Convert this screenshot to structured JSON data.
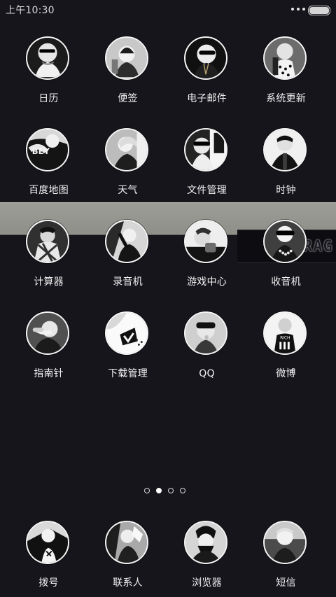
{
  "status_bar": {
    "time": "上午10:30",
    "icons": [
      "more-dots-icon",
      "battery-icon"
    ]
  },
  "apps": [
    {
      "name": "calendar",
      "label": "日历",
      "icon": "calendar-icon"
    },
    {
      "name": "notes",
      "label": "便签",
      "icon": "notes-icon"
    },
    {
      "name": "email",
      "label": "电子邮件",
      "icon": "email-icon"
    },
    {
      "name": "system-update",
      "label": "系统更新",
      "icon": "system-update-icon"
    },
    {
      "name": "baidu-map",
      "label": "百度地图",
      "icon": "map-icon"
    },
    {
      "name": "weather",
      "label": "天气",
      "icon": "weather-icon"
    },
    {
      "name": "file-manager",
      "label": "文件管理",
      "icon": "file-manager-icon"
    },
    {
      "name": "clock",
      "label": "时钟",
      "icon": "clock-icon"
    },
    {
      "name": "calculator",
      "label": "计算器",
      "icon": "calculator-icon"
    },
    {
      "name": "recorder",
      "label": "录音机",
      "icon": "recorder-icon"
    },
    {
      "name": "game-center",
      "label": "游戏中心",
      "icon": "game-center-icon"
    },
    {
      "name": "radio",
      "label": "收音机",
      "icon": "radio-icon"
    },
    {
      "name": "compass",
      "label": "指南针",
      "icon": "compass-icon"
    },
    {
      "name": "download-manager",
      "label": "下载管理",
      "icon": "download-icon"
    },
    {
      "name": "qq",
      "label": "QQ",
      "icon": "qq-icon"
    },
    {
      "name": "weibo",
      "label": "微博",
      "icon": "weibo-icon"
    }
  ],
  "page_indicator": {
    "count": 4,
    "active_index": 1
  },
  "dock": [
    {
      "name": "dialer",
      "label": "拨号",
      "icon": "phone-icon"
    },
    {
      "name": "contacts",
      "label": "联系人",
      "icon": "contacts-icon"
    },
    {
      "name": "browser",
      "label": "浏览器",
      "icon": "browser-icon"
    },
    {
      "name": "messages",
      "label": "短信",
      "icon": "messages-icon"
    }
  ],
  "wallpaper": {
    "text": "RAG",
    "colors": {
      "background": "#16151c",
      "band": "#9d9d97",
      "icon_border": "#f4f4f4",
      "label": "#f2f2f2"
    }
  }
}
